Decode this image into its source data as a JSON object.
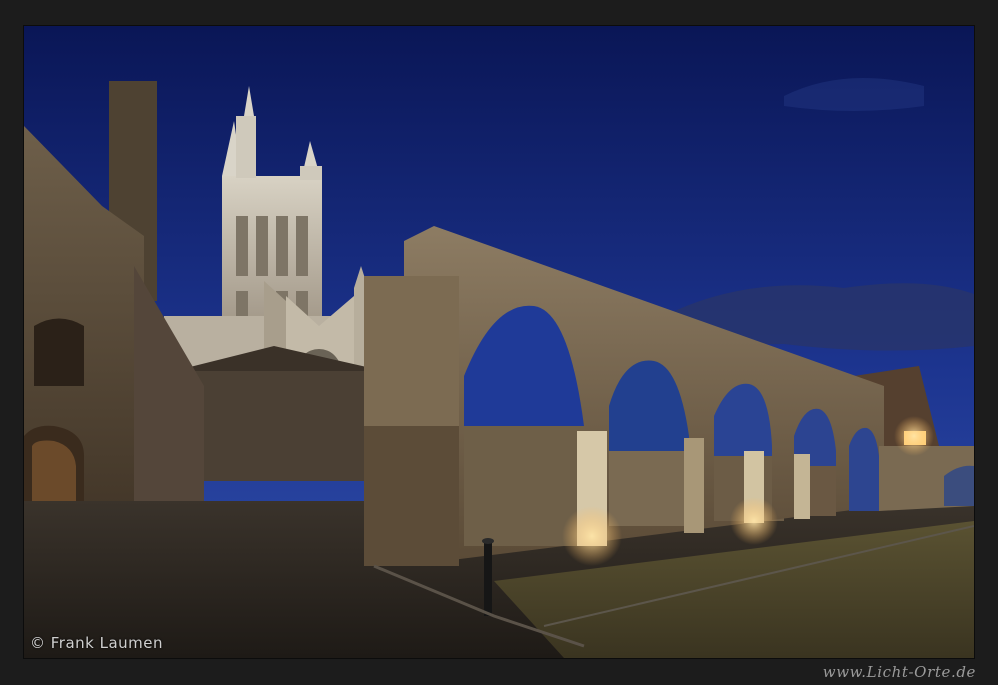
{
  "photo": {
    "credit": "© Frank Laumen",
    "website": "www.Licht-Orte.de",
    "colors": {
      "sky_top": "#0c1a5c",
      "sky_bottom": "#2d4aa8",
      "stone_lit": "#c8b58a",
      "stone_dark": "#3a2e22",
      "ground": "#2a2420",
      "lamp_glow": "#ffd27a"
    },
    "icons": [
      "cathedral-tower",
      "gothic-arch-ruin",
      "bollard",
      "lantern"
    ]
  }
}
